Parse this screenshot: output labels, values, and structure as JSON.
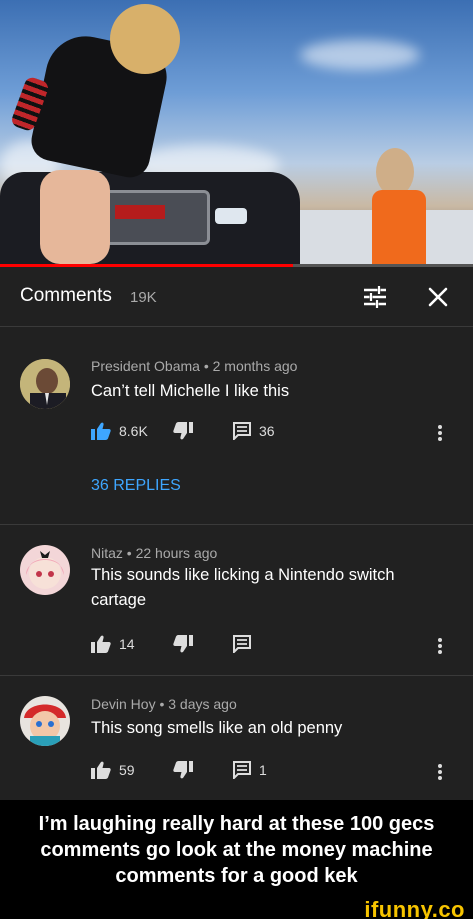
{
  "video": {
    "progress_fraction": 0.62
  },
  "comments_header": {
    "title": "Comments",
    "count": "19K"
  },
  "comments": [
    {
      "author": "President Obama",
      "time": "2 months ago",
      "meta": "President Obama • 2 months ago",
      "text": "Can’t tell Michelle I like this",
      "likes": "8.6K",
      "replies_count": "36",
      "replies_link": "36 REPLIES",
      "liked": true
    },
    {
      "author": "Nitaz",
      "time": "22 hours ago",
      "meta": "Nitaz • 22 hours ago",
      "text": "This sounds like licking a Nintendo switch cartage",
      "likes": "14",
      "replies_count": "",
      "liked": false
    },
    {
      "author": "Devin Hoy",
      "time": "3 days ago",
      "meta": "Devin Hoy • 3 days ago",
      "text": "This song smells like an old penny",
      "likes": "59",
      "replies_count": "1",
      "liked": false
    }
  ],
  "caption": "I’m laughing really hard at these 100 gecs comments go look at the money machine comments for a good kek",
  "watermark": "ifunny.co",
  "colors": {
    "accent_blue": "#3ea6ff",
    "progress_red": "#ff0000",
    "panel_bg": "#212121",
    "watermark_yellow": "#f7c400"
  }
}
